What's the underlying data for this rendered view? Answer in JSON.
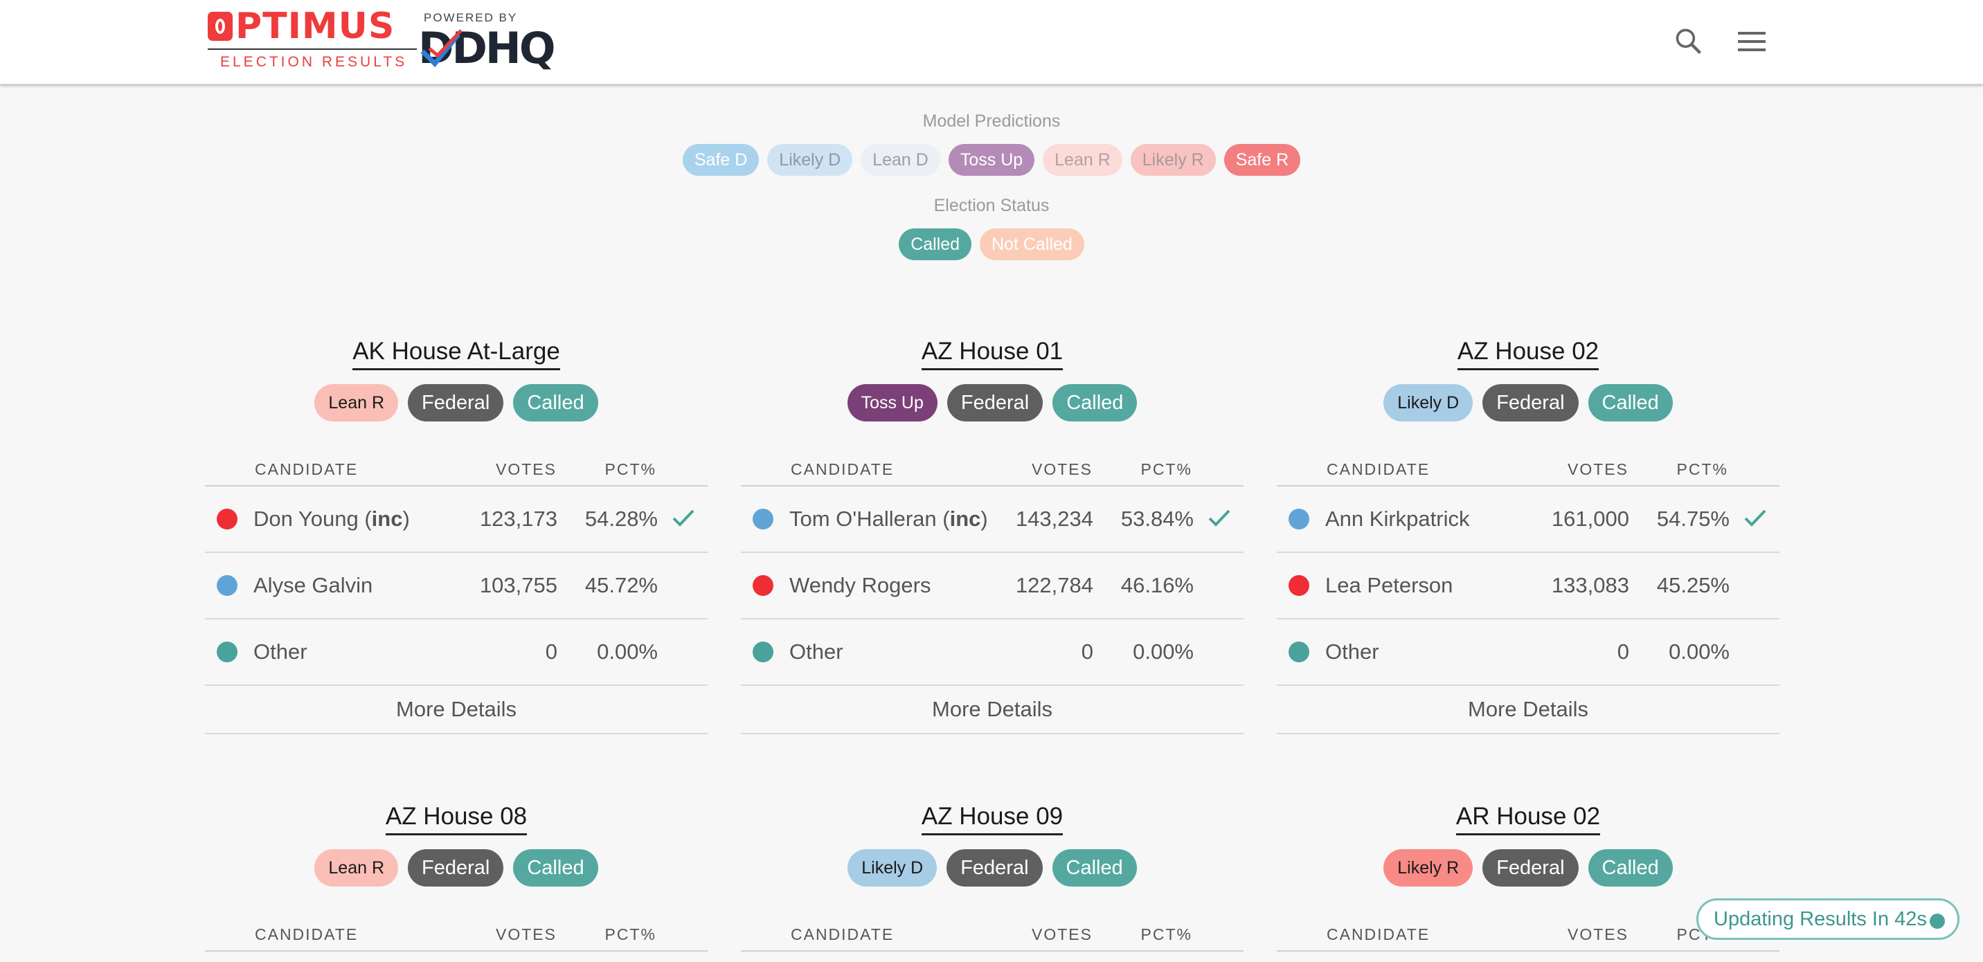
{
  "header": {
    "brand": "PTIMUS",
    "brand_sub": "ELECTION RESULTS",
    "powered_by": "POWERED BY",
    "partner": "DDHQ"
  },
  "filters": {
    "predictions_title": "Model Predictions",
    "predictions": [
      {
        "label": "Safe D",
        "bg": "#a9d3ec",
        "fg": "#ffffff"
      },
      {
        "label": "Likely D",
        "bg": "#cfe3f2",
        "fg": "#8a9aa8"
      },
      {
        "label": "Lean D",
        "bg": "#eceff3",
        "fg": "#9aa0a6"
      },
      {
        "label": "Toss Up",
        "bg": "#b48bb7",
        "fg": "#ffffff"
      },
      {
        "label": "Lean R",
        "bg": "#fbdcd8",
        "fg": "#b3a2a0"
      },
      {
        "label": "Likely R",
        "bg": "#f8c3c0",
        "fg": "#a89a99"
      },
      {
        "label": "Safe R",
        "bg": "#f37e80",
        "fg": "#ffffff"
      }
    ],
    "status_title": "Election Status",
    "status": [
      {
        "label": "Called",
        "bg": "#54a8a0",
        "fg": "#ffffff"
      },
      {
        "label": "Not Called",
        "bg": "#fbcdb8",
        "fg": "#ffffff"
      }
    ]
  },
  "table_headers": {
    "candidate": "CANDIDATE",
    "votes": "VOTES",
    "pct": "PCT%"
  },
  "more_details": "More Details",
  "colors": {
    "republican": "#ee2d35",
    "democrat": "#60a4d6",
    "other": "#4aa39a",
    "called_check": "#4aa39a"
  },
  "races": [
    {
      "title": "AK House At-Large",
      "rating": "Lean R",
      "rating_bg": "#fbbeb6",
      "level": "Federal",
      "status": "Called",
      "candidates": [
        {
          "name": "Don Young (",
          "inc": "inc",
          "close": ")",
          "votes": "123,173",
          "pct": "54.28%",
          "party": "R",
          "winner": true
        },
        {
          "name": "Alyse Galvin",
          "inc": "",
          "close": "",
          "votes": "103,755",
          "pct": "45.72%",
          "party": "D",
          "winner": false
        },
        {
          "name": "Other",
          "inc": "",
          "close": "",
          "votes": "0",
          "pct": "0.00%",
          "party": "O",
          "winner": false
        }
      ]
    },
    {
      "title": "AZ House 01",
      "rating": "Toss Up",
      "rating_bg": "#7c4078",
      "level": "Federal",
      "status": "Called",
      "candidates": [
        {
          "name": "Tom O'Halleran (",
          "inc": "inc",
          "close": ")",
          "votes": "143,234",
          "pct": "53.84%",
          "party": "D",
          "winner": true
        },
        {
          "name": "Wendy Rogers",
          "inc": "",
          "close": "",
          "votes": "122,784",
          "pct": "46.16%",
          "party": "R",
          "winner": false
        },
        {
          "name": "Other",
          "inc": "",
          "close": "",
          "votes": "0",
          "pct": "0.00%",
          "party": "O",
          "winner": false
        }
      ]
    },
    {
      "title": "AZ House 02",
      "rating": "Likely D",
      "rating_bg": "#a6cce6",
      "level": "Federal",
      "status": "Called",
      "candidates": [
        {
          "name": "Ann Kirkpatrick",
          "inc": "",
          "close": "",
          "votes": "161,000",
          "pct": "54.75%",
          "party": "D",
          "winner": true
        },
        {
          "name": "Lea Peterson",
          "inc": "",
          "close": "",
          "votes": "133,083",
          "pct": "45.25%",
          "party": "R",
          "winner": false
        },
        {
          "name": "Other",
          "inc": "",
          "close": "",
          "votes": "0",
          "pct": "0.00%",
          "party": "O",
          "winner": false
        }
      ]
    },
    {
      "title": "AZ House 08",
      "rating": "Lean R",
      "rating_bg": "#fbbeb6",
      "level": "Federal",
      "status": "Called",
      "candidates": []
    },
    {
      "title": "AZ House 09",
      "rating": "Likely D",
      "rating_bg": "#a6cce6",
      "level": "Federal",
      "status": "Called",
      "candidates": []
    },
    {
      "title": "AR House 02",
      "rating": "Likely R",
      "rating_bg": "#f88b86",
      "level": "Federal",
      "status": "Called",
      "candidates": []
    }
  ],
  "update_badge": "Updating Results In 42s"
}
